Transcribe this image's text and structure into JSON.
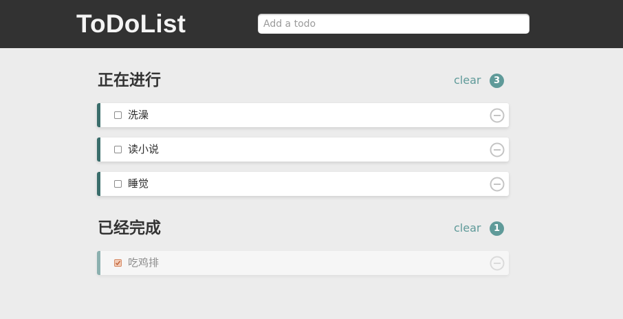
{
  "app": {
    "title": "ToDoList",
    "input_placeholder": "Add a todo",
    "input_value": ""
  },
  "sections": [
    {
      "title": "正在进行",
      "clear_label": "clear",
      "count": "3",
      "items": [
        {
          "text": "洗澡",
          "done": false
        },
        {
          "text": "读小说",
          "done": false
        },
        {
          "text": "睡觉",
          "done": false
        }
      ]
    },
    {
      "title": "已经完成",
      "clear_label": "clear",
      "count": "1",
      "items": [
        {
          "text": "吃鸡排",
          "done": true
        }
      ]
    }
  ],
  "icons": {
    "remove": "minus-circle-icon",
    "check": "checkmark-icon"
  },
  "colors": {
    "header_bg": "#323232",
    "page_bg": "#ececec",
    "accent": "#5f9a99",
    "active_border": "#3a6d6b",
    "done_border": "#8bb0af"
  }
}
